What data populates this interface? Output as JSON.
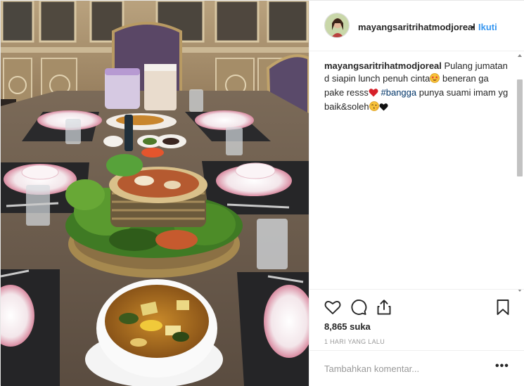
{
  "post": {
    "username": "mayangsaritrihatmodjoreal",
    "dot": "•",
    "follow_label": "Ikuti",
    "caption": {
      "username": "mayangsaritrihatmodjoreal",
      "text_1": "Pulang jumatan d siapin lunch penuh cinta",
      "emoji_1": "star-struck-emoji",
      "text_2": "beneran ga pake resss",
      "emoji_2": "heart-emoji",
      "hashtag": "#bangga",
      "text_3": "punya suami imam yg baik&soleh",
      "emoji_3": "kissing-face-emoji",
      "emoji_4": "black-heart-emoji"
    },
    "likes": "8,865 suka",
    "timestamp": "1 HARI YANG LALU",
    "comment_placeholder": "Tambahkan komentar...",
    "more_label": "•••"
  },
  "icons": {
    "like": "heart-outline-icon",
    "comment": "speech-bubble-icon",
    "share": "share-icon",
    "save": "bookmark-icon"
  },
  "colors": {
    "link": "#3897f0",
    "hashtag": "#003569",
    "text": "#262626",
    "muted": "#999999",
    "border": "#efefef"
  }
}
